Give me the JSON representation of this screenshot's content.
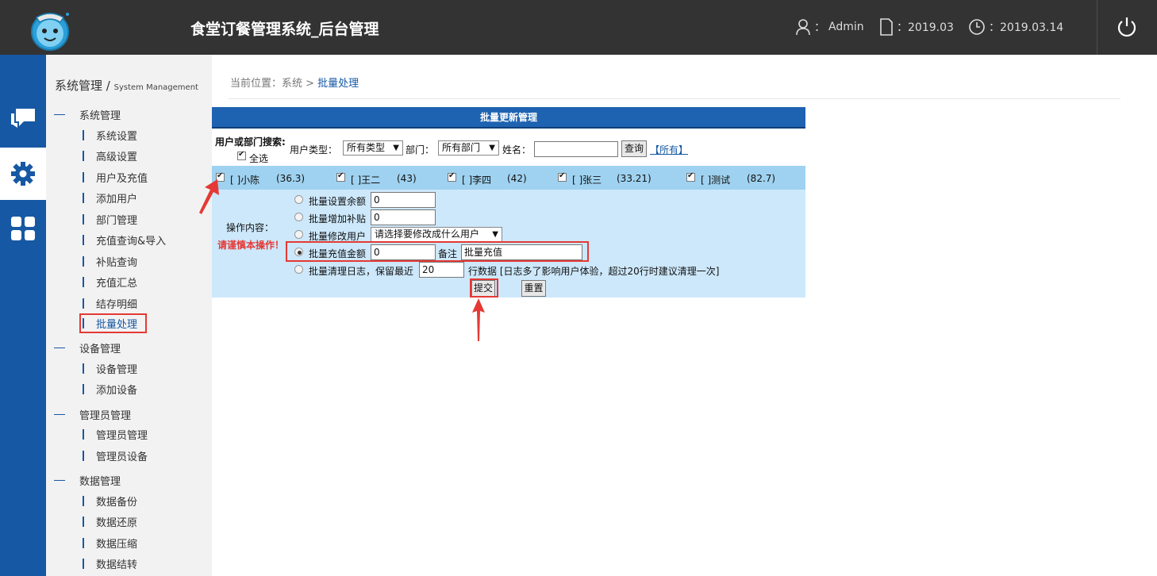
{
  "header": {
    "title": "食堂订餐管理系统_后台管理",
    "user": "Admin",
    "month_label": "：2019.03",
    "date_label": "：2019.03.14",
    "user_sep": "："
  },
  "sidebar": {
    "title": "系统管理 /",
    "title_en": "System Management",
    "groups": [
      {
        "label": "系统管理",
        "items": [
          "系统设置",
          "高级设置",
          "用户及充值",
          "添加用户",
          "部门管理",
          "充值查询&导入",
          "补贴查询",
          "充值汇总",
          "结存明细",
          "批量处理"
        ]
      },
      {
        "label": "设备管理",
        "items": [
          "设备管理",
          "添加设备"
        ]
      },
      {
        "label": "管理员管理",
        "items": [
          "管理员管理",
          "管理员设备"
        ]
      },
      {
        "label": "数据管理",
        "items": [
          "数据备份",
          "数据还原",
          "数据压缩",
          "数据结转"
        ]
      }
    ]
  },
  "breadcrumb": {
    "prefix": "当前位置：系统 >",
    "current": "批量处理"
  },
  "panel": {
    "title": "批量更新管理",
    "search_label": "用户或部门搜索:",
    "select_all": "全选",
    "user_type_label": "用户类型：",
    "user_type_value": "所有类型",
    "dept_label": "部门：",
    "dept_value": "所有部门",
    "name_label": "姓名：",
    "name_value": "",
    "query_button": "查询",
    "all_link": "【所有】",
    "users": [
      {
        "label": "[  ]小陈",
        "amount": "(36.3)"
      },
      {
        "label": "[  ]王二",
        "amount": "(43)"
      },
      {
        "label": "[  ]李四",
        "amount": "(42)"
      },
      {
        "label": "[  ]张三",
        "amount": "(33.21)"
      },
      {
        "label": "[  ]测试",
        "amount": "(82.7)"
      }
    ],
    "ops_label": "操作内容：",
    "warning": "请谨慎本操作！",
    "op_set_balance": "批量设置余额",
    "op_set_balance_value": "0",
    "op_add_subsidy": "批量增加补贴",
    "op_add_subsidy_value": "0",
    "op_modify_user": "批量修改用户",
    "op_modify_user_select": "请选择要修改成什么用户",
    "op_recharge": "批量充值金额",
    "op_recharge_value": "0",
    "remark_label": "备注",
    "remark_value": "批量充值",
    "op_clean_log": "批量清理日志，保留最近",
    "op_clean_log_value": "20",
    "op_clean_log_suffix": "行数据 [日志多了影响用户体验，超过20行时建议清理一次]",
    "submit_button": "提交",
    "reset_button": "重置"
  },
  "colors": {
    "header_bg": "#333333",
    "rail_bg": "#1658a3",
    "panel_head": "#1e63b1",
    "users_row": "#9fd2f0",
    "ops_bg": "#cde8fb",
    "highlight": "#e53935"
  }
}
